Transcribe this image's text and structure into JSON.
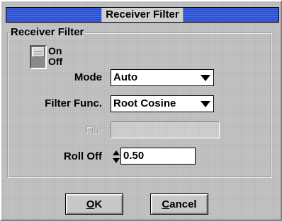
{
  "window": {
    "title": "Receiver Filter"
  },
  "group": {
    "label": "Receiver Filter"
  },
  "toggle": {
    "on_label": "On",
    "off_label": "Off",
    "state": "On"
  },
  "fields": {
    "mode": {
      "label": "Mode",
      "value": "Auto"
    },
    "filter_func": {
      "label": "Filter Func.",
      "value": "Root Cosine"
    },
    "file": {
      "label": "File",
      "value": ""
    },
    "roll_off": {
      "label": "Roll Off",
      "value": "0.50"
    }
  },
  "buttons": {
    "ok": {
      "mnemonic": "O",
      "rest": "K"
    },
    "cancel": {
      "mnemonic": "C",
      "rest": "ancel"
    }
  },
  "icons": [
    "chevron-down-icon",
    "spin-arrows-icon",
    "toggle-switch-icon"
  ],
  "colors": {
    "titlebar": "#2a4ec8",
    "face": "#c4c4c4",
    "field": "#ffffff"
  }
}
